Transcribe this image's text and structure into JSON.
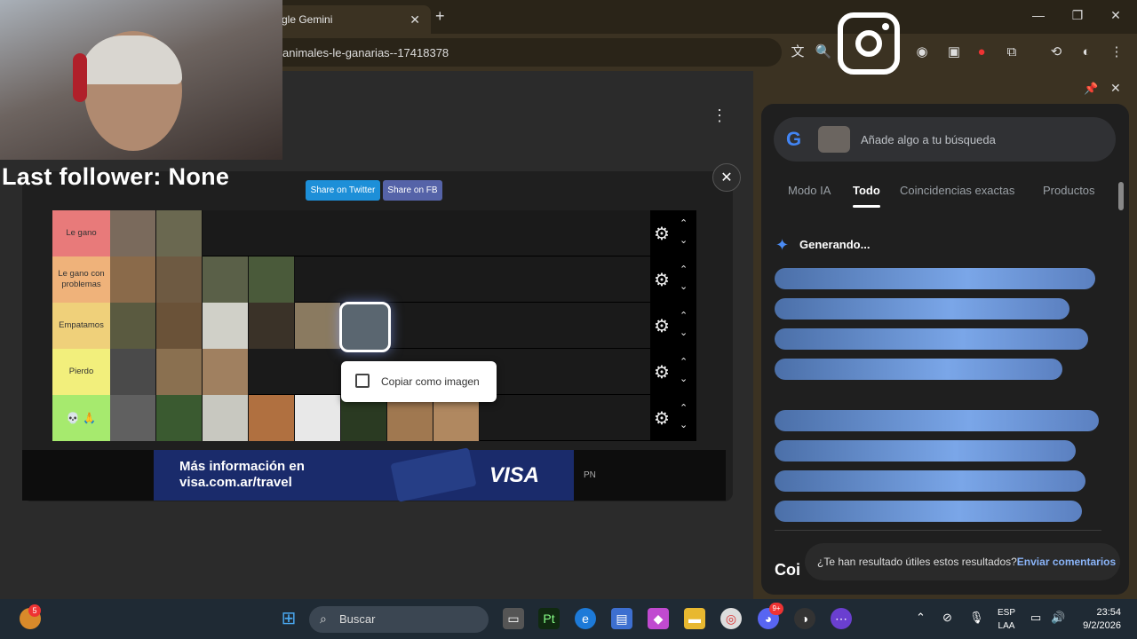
{
  "browser": {
    "tab_title": "gle Gemini",
    "tab_close": "✕",
    "new_tab": "+",
    "url": "animales-le-ganarias--17418378",
    "window": {
      "minimize": "—",
      "maximize": "❐",
      "close": "✕"
    }
  },
  "stream_overlay": {
    "last_follower": "Last follower: None"
  },
  "page": {
    "menu_icon": "⋮",
    "modal_close": "✕",
    "share_twitter": "Share on Twitter",
    "share_fb": "Share on FB",
    "tiers": [
      {
        "label": "Le gano",
        "color": "#e87a7a",
        "count": 2
      },
      {
        "label": "Le gano con problemas",
        "color": "#efb27a",
        "count": 4
      },
      {
        "label": "Empatamos",
        "color": "#efd07a",
        "count": 6
      },
      {
        "label": "Pierdo",
        "color": "#f2ef7c",
        "count": 3
      },
      {
        "label": "💀 🙏",
        "color": "#a6ea6e",
        "count": 8
      }
    ],
    "tier_gear": "⚙",
    "tier_up": "⌃",
    "tier_down": "⌄",
    "context_menu": {
      "copy_image": "Copiar como imagen"
    },
    "ad": {
      "text_line1": "Más información en",
      "text_line2": "visa.com.ar/travel",
      "brand": "VISA",
      "side": "PN"
    }
  },
  "side_panel": {
    "search_placeholder": "Añade algo a tu búsqueda",
    "google_g": "G",
    "tabs": [
      "Modo IA",
      "Todo",
      "Coincidencias exactas",
      "Productos"
    ],
    "active_tab": "Todo",
    "generating": "Generando...",
    "section_title_partial": "Coi",
    "feedback_question": "¿Te han resultado útiles estos resultados?",
    "feedback_link": "Enviar comentarios",
    "pin": "📌",
    "close": "✕"
  },
  "taskbar": {
    "search_label": "Buscar",
    "lang_1": "ESP",
    "lang_2": "LAA",
    "time": "23:54",
    "date": "9/2/2026",
    "notif_badge": "5",
    "discord_badge": "9+"
  }
}
